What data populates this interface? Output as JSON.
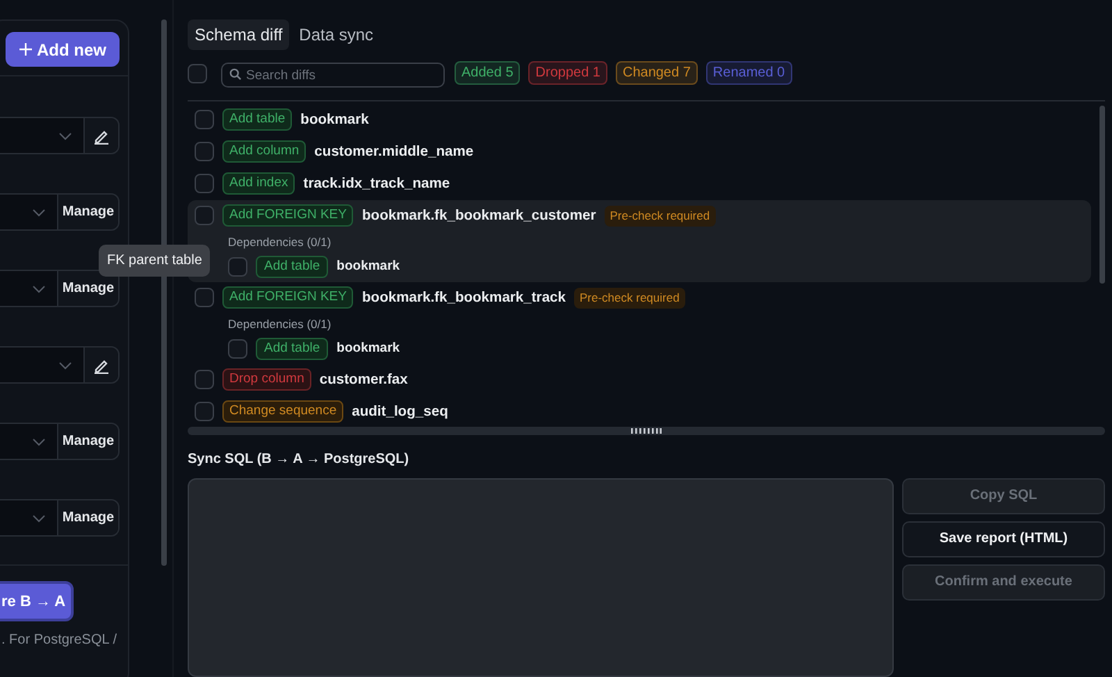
{
  "sidebar": {
    "add_button": "Add new",
    "controls": [
      {
        "kind": "edit"
      },
      {
        "kind": "manage",
        "label": "Manage"
      },
      {
        "kind": "manage",
        "label": "Manage"
      },
      {
        "kind": "edit"
      },
      {
        "kind": "manage",
        "label": "Manage"
      },
      {
        "kind": "manage",
        "label": "Manage"
      }
    ],
    "run_button": "re B → A",
    "note": ". For PostgreSQL /"
  },
  "tooltip": "FK parent table",
  "tabs": [
    {
      "label": "Schema diff",
      "selected": true
    },
    {
      "label": "Data sync",
      "selected": false
    }
  ],
  "select_all": {
    "checked": false
  },
  "search": {
    "placeholder": "Search diffs"
  },
  "filters": [
    {
      "label": "Added 5",
      "color": "#3fb068"
    },
    {
      "label": "Dropped 1",
      "color": "#d0393e"
    },
    {
      "label": "Changed 7",
      "color": "#d08a22"
    },
    {
      "label": "Renamed 0",
      "color": "#5a5fd6"
    }
  ],
  "diffs": [
    {
      "kind": "add",
      "action": "Add table",
      "target": "bookmark",
      "checked": false,
      "hovered": false
    },
    {
      "kind": "add",
      "action": "Add column",
      "target": "customer.middle_name",
      "checked": false,
      "hovered": false
    },
    {
      "kind": "add",
      "action": "Add index",
      "target": "track.idx_track_name",
      "checked": false,
      "hovered": false
    },
    {
      "kind": "add",
      "action": "Add FOREIGN KEY",
      "target": "bookmark.fk_bookmark_customer",
      "precheck": "Pre-check required",
      "checked": false,
      "hovered": true,
      "dependencies": {
        "label": "Dependencies (0/1)",
        "items": [
          {
            "kind": "add",
            "action": "Add table",
            "target": "bookmark",
            "checked": false
          }
        ]
      }
    },
    {
      "kind": "add",
      "action": "Add FOREIGN KEY",
      "target": "bookmark.fk_bookmark_track",
      "precheck": "Pre-check required",
      "checked": false,
      "hovered": false,
      "dependencies": {
        "label": "Dependencies (0/1)",
        "items": [
          {
            "kind": "add",
            "action": "Add table",
            "target": "bookmark",
            "checked": false
          }
        ]
      }
    },
    {
      "kind": "drop",
      "action": "Drop column",
      "target": "customer.fax",
      "checked": false,
      "hovered": false
    },
    {
      "kind": "change",
      "action": "Change sequence",
      "target": "audit_log_seq",
      "checked": false,
      "hovered": false
    }
  ],
  "sql": {
    "title": "Sync SQL (B → A → PostgreSQL)"
  },
  "actions": [
    {
      "label": "Copy SQL",
      "disabled": true
    },
    {
      "label": "Save report (HTML)",
      "disabled": false
    },
    {
      "label": "Confirm and execute",
      "disabled": true
    }
  ]
}
